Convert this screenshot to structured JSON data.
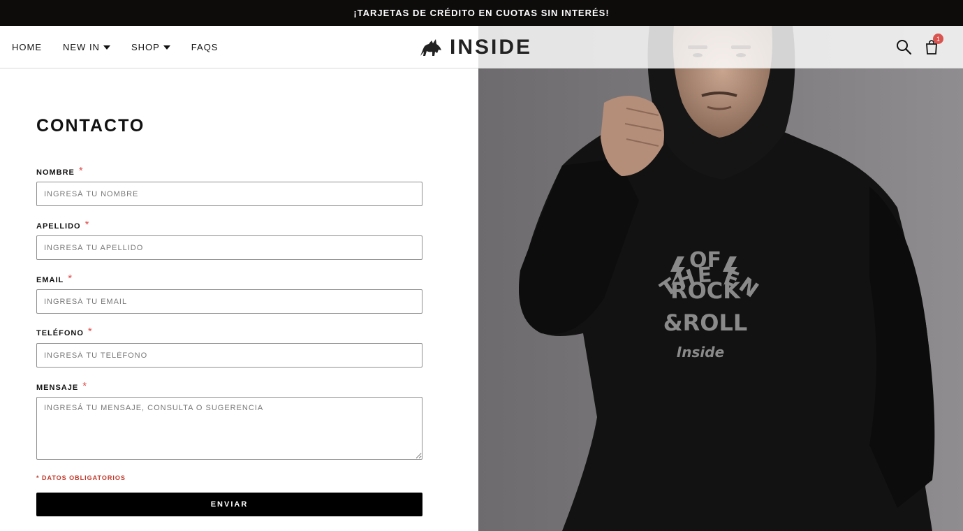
{
  "promo": {
    "text": "¡TARJETAS DE CRÉDITO EN CUOTAS SIN INTERÉS!"
  },
  "nav": {
    "items": [
      {
        "label": "HOME",
        "has_dropdown": false
      },
      {
        "label": "NEW IN",
        "has_dropdown": true
      },
      {
        "label": "SHOP",
        "has_dropdown": true
      },
      {
        "label": "FAQS",
        "has_dropdown": false
      }
    ]
  },
  "logo": {
    "text": "INSIDE",
    "icon": "wolf-icon"
  },
  "header_icons": {
    "search": "search-icon",
    "cart": "cart-icon",
    "cart_count": "1"
  },
  "contact": {
    "title": "CONTACTO",
    "fields": [
      {
        "label": "NOMBRE",
        "required": "*",
        "placeholder": "INGRESÁ TU NOMBRE",
        "value": ""
      },
      {
        "label": "APELLIDO",
        "required": "*",
        "placeholder": "INGRESÁ TU APELLIDO",
        "value": ""
      },
      {
        "label": "EMAIL",
        "required": "*",
        "placeholder": "INGRESÁ TU EMAIL",
        "value": ""
      },
      {
        "label": "TELÉFONO",
        "required": "*",
        "placeholder": "INGRESÁ TU TELÉFONO",
        "value": ""
      },
      {
        "label": "MENSAJE",
        "required": "*",
        "placeholder": "INGRESÁ TU MENSAJE, CONSULTA O SUGERENCIA",
        "value": ""
      }
    ],
    "required_note": "* DATOS OBLIGATORIOS",
    "submit_label": "ENVIAR"
  },
  "hero_image": {
    "shirt_text": {
      "arc": "FEEL THE ENERGY",
      "line1": "OF",
      "line2": "ROCK",
      "line3": "&ROLL",
      "brand": "Inside"
    }
  },
  "colors": {
    "promo_bg": "#0e0b0b",
    "accent_required": "#e14d4d",
    "button_bg": "#000000",
    "badge": "#d9534f"
  }
}
